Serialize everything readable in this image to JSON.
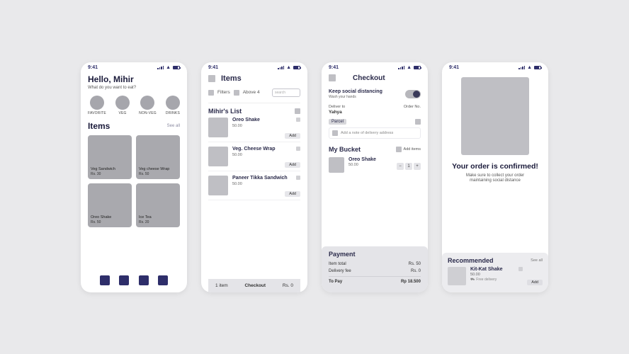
{
  "status": {
    "time": "9:41"
  },
  "screen1": {
    "greeting": "Hello, Mihir",
    "subgreeting": "What do you want to eat?",
    "categories": [
      {
        "label": "FAVORITE"
      },
      {
        "label": "VEG"
      },
      {
        "label": "NON-VEG"
      },
      {
        "label": "DRINKS"
      }
    ],
    "items_heading": "Items",
    "see_all": "See all",
    "cards": [
      {
        "name": "Veg Sandwich",
        "price": "Rs. 30"
      },
      {
        "name": "Veg cheese Wrap",
        "price": "Rs. 50"
      },
      {
        "name": "Oreo Shake",
        "price": "Rs. 50"
      },
      {
        "name": "Ice Tea",
        "price": "Rs. 20"
      }
    ]
  },
  "screen2": {
    "title": "Items",
    "filters_label": "Filters",
    "above4_label": "Above 4",
    "search_placeholder": "search",
    "list_title": "Mihir's List",
    "items": [
      {
        "name": "Oreo Shake",
        "price": "50.00",
        "btn": "Add"
      },
      {
        "name": "Veg. Cheese Wrap",
        "price": "50.00",
        "btn": "Add"
      },
      {
        "name": "Paneer Tikka Sandwich",
        "price": "50.00",
        "btn": "Add"
      }
    ],
    "bottom": {
      "count": "1 item",
      "checkout": "Checkout",
      "price": "Rs. 0"
    }
  },
  "screen3": {
    "title": "Checkout",
    "social_title": "Keep social distancing",
    "social_sub": "Wash your hands",
    "deliver_to_label": "Deliver to",
    "deliver_name": "Yahya",
    "order_no_label": "Order No.",
    "parcel": "Parcel",
    "note_placeholder": "Add a note of delivery address",
    "bucket_title": "My Bucket",
    "add_items": "Add items",
    "bucket_items": [
      {
        "name": "Oreo Shake",
        "price": "50.00"
      }
    ],
    "qty_value": "1",
    "payment": {
      "title": "Payment",
      "lines": [
        {
          "label": "Item total",
          "value": "Rs. 50"
        },
        {
          "label": "Delivery fee",
          "value": "Rs. 0"
        }
      ],
      "total_label": "To Pay",
      "total_value": "Rp 18.500"
    }
  },
  "screen4": {
    "title": "Your order is confirmed!",
    "subtitle": "Make sure to collect your order maintaining social distance",
    "rec_title": "Recommended",
    "see_all": "See all",
    "rec_item": {
      "name": "Kit-Kat Shake",
      "price": "50.00",
      "delivery": "Free delivery",
      "btn": "Add"
    }
  }
}
